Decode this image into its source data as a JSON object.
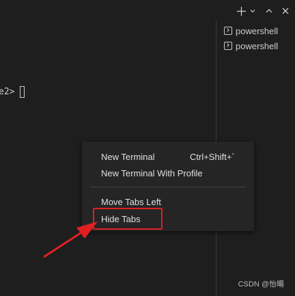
{
  "terminal": {
    "prompt_fragment": "e2>",
    "tabs": [
      {
        "label": "powershell"
      },
      {
        "label": "powershell"
      }
    ]
  },
  "toolbar": {
    "icons": [
      "add-icon",
      "chevron-down-icon",
      "chevron-up-icon",
      "close-icon"
    ]
  },
  "context_menu": {
    "items": [
      {
        "label": "New Terminal",
        "shortcut": "Ctrl+Shift+`"
      },
      {
        "label": "New Terminal With Profile",
        "shortcut": ""
      },
      {
        "label": "Move Tabs Left",
        "shortcut": ""
      },
      {
        "label": "Hide Tabs",
        "shortcut": ""
      }
    ]
  },
  "annotation": {
    "highlight_color": "#e02020"
  },
  "watermark": {
    "text": "CSDN @怡暘"
  },
  "colors": {
    "background": "#1e1e1e",
    "menu_background": "#252526",
    "text": "#cccccc"
  }
}
